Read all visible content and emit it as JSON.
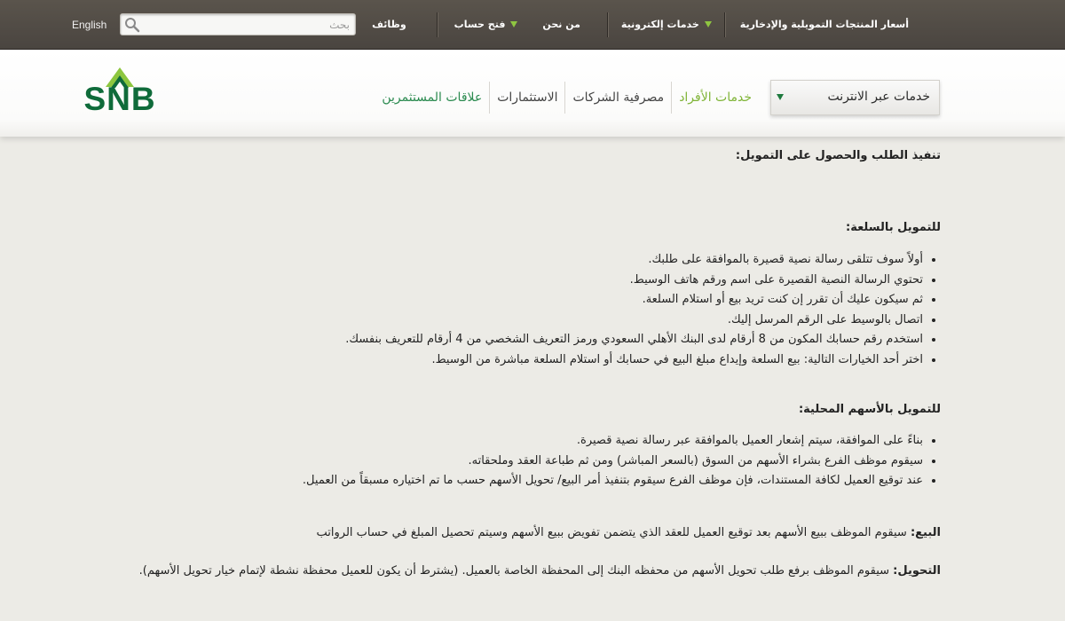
{
  "topbar": {
    "lang": "English",
    "search_placeholder": "بحث",
    "links": [
      {
        "label": "أسعار المنتجات التمويلية والإدخارية",
        "dropdown": false
      },
      {
        "label": "خدمات إلكترونية",
        "dropdown": true
      },
      {
        "label": "من نحن",
        "dropdown": false
      },
      {
        "label": "فتح حساب",
        "dropdown": true
      },
      {
        "label": "وظائف",
        "dropdown": false
      }
    ]
  },
  "header": {
    "logo_text": "SNB",
    "online_services": "خدمات عبر الانترنت",
    "nav": [
      {
        "label": "خدمات الأفراد",
        "state": "active"
      },
      {
        "label": "مصرفية الشركات",
        "state": "normal"
      },
      {
        "label": "الاستثمارات",
        "state": "normal"
      },
      {
        "label": "علاقات المستثمرين",
        "state": "green"
      }
    ]
  },
  "content": {
    "heading": "تنفيذ الطلب والحصول على التمويل:",
    "commodity": {
      "title": "للتمويل بالسلعة:",
      "items": [
        "أولاً سوف تتلقى رسالة نصية قصيرة بالموافقة على طلبك.",
        "تحتوي الرسالة النصية القصيرة على اسم ورقم هاتف الوسيط.",
        " ثم سيكون عليك أن تقرر إن كنت تريد بيع أو استلام السلعة.",
        "اتصال بالوسيط على الرقم المرسل إليك.",
        " استخدم رقم حسابك المكون من 8 أرقام لدى البنك الأهلي السعودي ورمز التعريف الشخصي من 4 أرقام للتعريف بنفسك.",
        "اختر أحد الخيارات التالية: بيع السلعة وإيداع مبلغ البيع في حسابك أو استلام السلعة مباشرة من الوسيط."
      ]
    },
    "shares": {
      "title": "للتمويل بالأسهم المحلية:",
      "items": [
        "بناءً على الموافقة، سيتم إشعار العميل بالموافقة عبر رسالة نصية قصيرة.",
        "سيقوم موظف الفرع بشراء الأسهم من السوق (بالسعر المباشر) ومن ثم طباعة العقد وملحقاته.",
        "عند توقيع العميل لكافة المستندات، فإن موظف الفرع سيقوم بتنفيذ أمر البيع/ تحويل الأسهم حسب ما تم اختياره مسبقاً من العميل."
      ]
    },
    "sale": {
      "label": "البيع:",
      "text": " سيقوم الموظف ببيع الأسهم بعد توقيع العميل للعقد الذي يتضمن تفويض ببيع الأسهم وسيتم تحصيل المبلغ في حساب الرواتب"
    },
    "transfer": {
      "label": "التحويل:",
      "text": " سيقوم الموظف برفع طلب تحويل الأسهم من محفظه البنك إلى المحفظة الخاصة بالعميل. (يشترط أن يكون للعميل محفظة نشطة لإتمام خيار تحويل الأسهم)."
    }
  }
}
